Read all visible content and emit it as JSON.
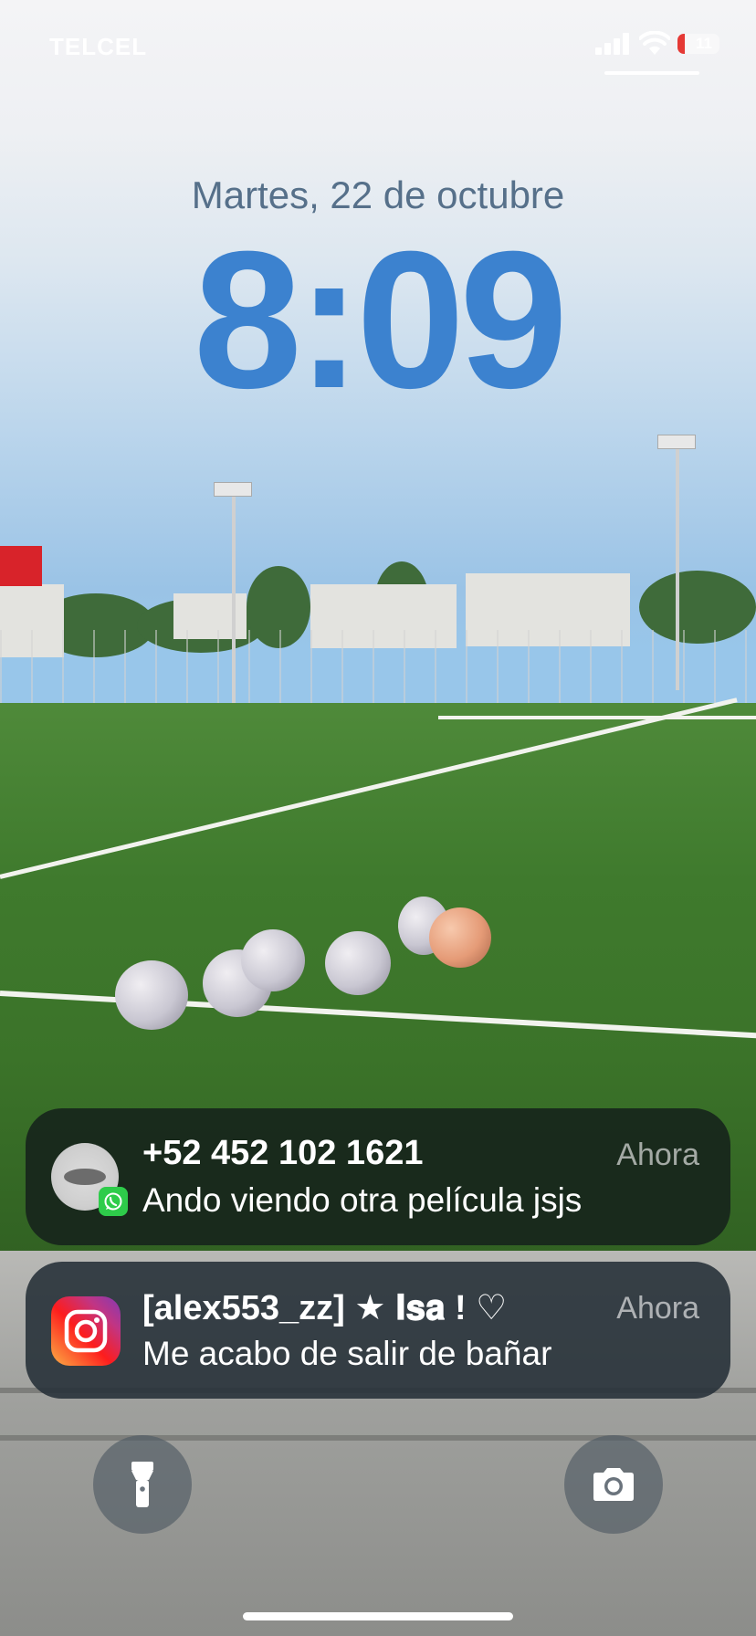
{
  "status_bar": {
    "carrier": "TELCEL",
    "battery_level": "11",
    "signal_bars": 4
  },
  "lock_screen": {
    "date": "Martes, 22 de octubre",
    "time": "8:09"
  },
  "notifications": [
    {
      "app": "WhatsApp",
      "title": "+52 452 102 1621",
      "time": "Ahora",
      "body": "Ando viendo otra película jsjs"
    },
    {
      "app": "Instagram",
      "title": "[alex553_zz] ★ 𝐈𝐬𝐚 ! ♡",
      "time": "Ahora",
      "body": "Me acabo de salir de bañar"
    }
  ],
  "controls": {
    "flashlight_icon": "flashlight-icon",
    "camera_icon": "camera-icon"
  },
  "colors": {
    "time": "#3c82cf",
    "date": "#56708a",
    "whatsapp": "#2ecc4a",
    "battery_low": "#e53935"
  }
}
